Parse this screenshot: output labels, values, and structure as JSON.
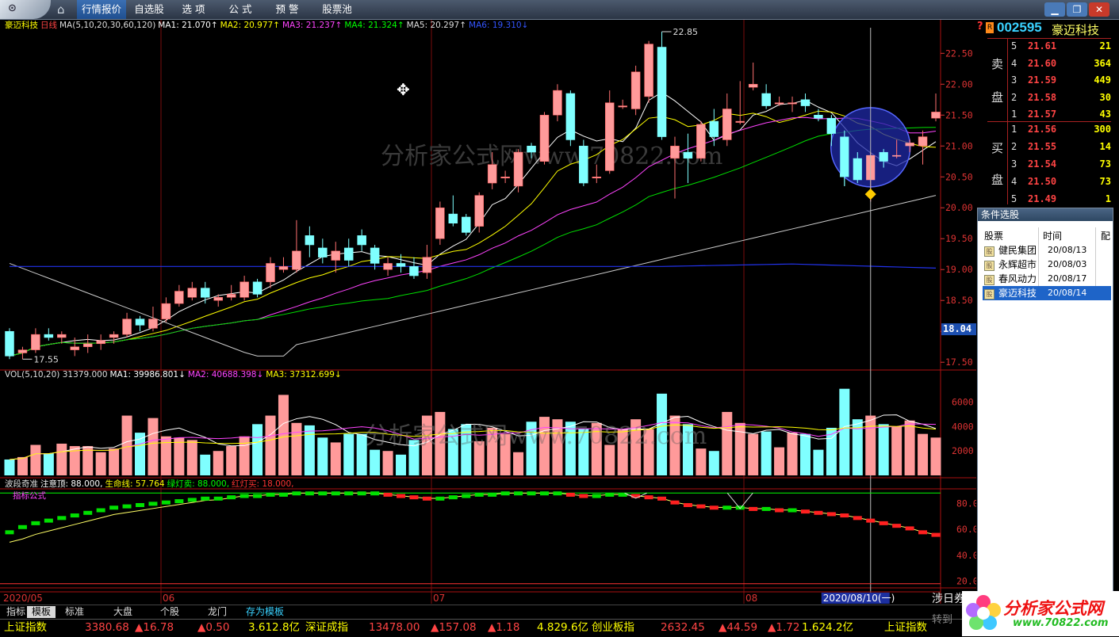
{
  "menu": {
    "items": [
      "行情报价",
      "自选股",
      "选 项",
      "公 式",
      "预 警",
      "股票池"
    ],
    "active": 0
  },
  "chart_header": {
    "stock": "豪迈科技",
    "period": "日线",
    "ma_params": "MA(5,10,20,30,60,120)",
    "ma_values": [
      {
        "label": "MA1: 21.070",
        "color": "#ffffff"
      },
      {
        "label": "MA2: 20.977",
        "color": "#ffff00"
      },
      {
        "label": "MA3: 21.237",
        "color": "#ff44ff"
      },
      {
        "label": "MA4: 21.324",
        "color": "#00ff00"
      },
      {
        "label": "MA5: 20.297",
        "color": "#dddddd"
      },
      {
        "label": "MA6: 19.310",
        "color": "#3355ff"
      }
    ]
  },
  "vol_header": {
    "label": "VOL(5,10,20) 31379.000",
    "ma_values": [
      {
        "label": "MA1: 39986.801",
        "color": "#ffffff"
      },
      {
        "label": "MA2: 40688.398",
        "color": "#ff44ff"
      },
      {
        "label": "MA3: 37312.699",
        "color": "#ffff00"
      }
    ]
  },
  "ind_header": {
    "name": "波段奇准",
    "items": [
      {
        "label": "注意顶: 88.000,",
        "color": "#ffffff"
      },
      {
        "label": "生命线: 57.764",
        "color": "#ffff00"
      },
      {
        "label": "绿灯卖: 88.000,",
        "color": "#00ff00"
      },
      {
        "label": "红灯买: 18.000,",
        "color": "#ff3333"
      }
    ],
    "sub": "指标公式"
  },
  "price_axis": [
    "22.50",
    "22.00",
    "21.50",
    "21.00",
    "20.50",
    "20.00",
    "19.50",
    "19.00",
    "18.50",
    "18.00",
    "17.50"
  ],
  "price_marker": "18.04",
  "high_label": "22.85",
  "low_label": "17.55",
  "vol_axis": [
    "6000",
    "4000",
    "2000"
  ],
  "ind_axis": [
    "80.0",
    "60.0",
    "40.0",
    "20.0"
  ],
  "date_axis": [
    "2020/05",
    "06",
    "07",
    "08"
  ],
  "cursor_date": "2020/08/10(一)",
  "watermark": "分析家公式网www.70822.com",
  "quote": {
    "code": "002595",
    "name": "豪迈科技",
    "sell_label": [
      "卖",
      "盘"
    ],
    "buy_label": [
      "买",
      "盘"
    ],
    "sell": [
      {
        "level": "5",
        "price": "21.61",
        "vol": "21"
      },
      {
        "level": "4",
        "price": "21.60",
        "vol": "364"
      },
      {
        "level": "3",
        "price": "21.59",
        "vol": "449"
      },
      {
        "level": "2",
        "price": "21.58",
        "vol": "30"
      },
      {
        "level": "1",
        "price": "21.57",
        "vol": "43"
      }
    ],
    "buy": [
      {
        "level": "1",
        "price": "21.56",
        "vol": "300"
      },
      {
        "level": "2",
        "price": "21.55",
        "vol": "14"
      },
      {
        "level": "3",
        "price": "21.54",
        "vol": "73"
      },
      {
        "level": "4",
        "price": "21.50",
        "vol": "73"
      },
      {
        "level": "5",
        "price": "21.49",
        "vol": "1"
      }
    ]
  },
  "panel": {
    "title": "条件选股",
    "headers": [
      "股票",
      "时间",
      "配"
    ],
    "rows": [
      {
        "name": "健民集团",
        "date": "20/08/13"
      },
      {
        "name": "永辉超市",
        "date": "20/08/03"
      },
      {
        "name": "春风动力",
        "date": "20/08/17"
      },
      {
        "name": "豪迈科技",
        "date": "20/08/14"
      }
    ],
    "selected": 3
  },
  "bottom_tabs": [
    "指标",
    "模板",
    "标准",
    "大盘",
    "个股",
    "龙门",
    "存为模板"
  ],
  "ticker": [
    {
      "text": "上证指数",
      "color": "#ffff00"
    },
    {
      "text": "3380.68",
      "color": "#ff4444"
    },
    {
      "text": "▲16.78",
      "color": "#ff4444"
    },
    {
      "text": "▲0.50",
      "color": "#ff4444"
    },
    {
      "text": "3.612.8亿",
      "color": "#ffff00"
    },
    {
      "text": "深证成指",
      "color": "#ffff00"
    },
    {
      "text": "13478.00",
      "color": "#ff4444"
    },
    {
      "text": "▲157.08",
      "color": "#ff4444"
    },
    {
      "text": "▲1.18",
      "color": "#ff4444"
    },
    {
      "text": "4.829.6亿",
      "color": "#ffff00"
    },
    {
      "text": "创业板指",
      "color": "#ffff00"
    },
    {
      "text": "2632.45",
      "color": "#ff4444"
    },
    {
      "text": "▲44.59",
      "color": "#ff4444"
    },
    {
      "text": "▲1.72",
      "color": "#ff4444"
    },
    {
      "text": "1.624.2亿",
      "color": "#ffff00"
    },
    {
      "text": "上证指数",
      "color": "#ffff00"
    }
  ],
  "side_text": "涉日券",
  "goto_text": "转到",
  "brand": {
    "name": "分析家公式网",
    "url": "www.70822.com"
  },
  "chart_data": {
    "type": "candlestick",
    "title": "豪迈科技 日线",
    "ylim": [
      17.4,
      22.85
    ],
    "candles": [
      [
        18.0,
        17.6,
        18.05,
        17.55
      ],
      [
        17.65,
        17.7,
        17.75,
        17.55
      ],
      [
        17.7,
        17.95,
        18.05,
        17.65
      ],
      [
        17.95,
        17.9,
        18.05,
        17.85
      ],
      [
        17.9,
        17.95,
        18.0,
        17.8
      ],
      [
        17.7,
        17.75,
        17.9,
        17.6
      ],
      [
        17.75,
        17.8,
        17.95,
        17.65
      ],
      [
        17.8,
        17.85,
        17.95,
        17.7
      ],
      [
        17.9,
        17.95,
        18.0,
        17.8
      ],
      [
        17.95,
        18.2,
        18.3,
        17.9
      ],
      [
        18.2,
        18.1,
        18.25,
        18.0
      ],
      [
        18.05,
        18.2,
        18.4,
        18.0
      ],
      [
        18.2,
        18.45,
        18.55,
        18.15
      ],
      [
        18.45,
        18.65,
        18.75,
        18.4
      ],
      [
        18.55,
        18.7,
        18.8,
        18.5
      ],
      [
        18.7,
        18.55,
        18.8,
        18.45
      ],
      [
        18.5,
        18.55,
        18.6,
        18.4
      ],
      [
        18.55,
        18.6,
        18.75,
        18.5
      ],
      [
        18.55,
        18.8,
        18.9,
        18.5
      ],
      [
        18.8,
        18.6,
        18.85,
        18.55
      ],
      [
        18.8,
        19.1,
        19.2,
        18.7
      ],
      [
        19.0,
        19.05,
        19.2,
        18.95
      ],
      [
        19.0,
        19.3,
        19.8,
        18.95
      ],
      [
        19.55,
        19.4,
        19.7,
        19.2
      ],
      [
        19.35,
        19.2,
        19.5,
        19.1
      ],
      [
        19.15,
        19.3,
        19.45,
        18.95
      ],
      [
        19.35,
        19.15,
        19.5,
        19.05
      ],
      [
        19.55,
        19.4,
        19.65,
        19.3
      ],
      [
        19.35,
        19.1,
        19.4,
        19.0
      ],
      [
        19.0,
        19.1,
        19.2,
        18.9
      ],
      [
        19.1,
        19.05,
        19.25,
        18.95
      ],
      [
        19.05,
        18.9,
        19.2,
        18.85
      ],
      [
        18.95,
        19.2,
        19.4,
        18.85
      ],
      [
        19.5,
        20.0,
        20.1,
        19.4
      ],
      [
        19.9,
        19.75,
        20.2,
        19.7
      ],
      [
        19.85,
        19.6,
        19.9,
        19.55
      ],
      [
        19.7,
        20.2,
        20.25,
        19.6
      ],
      [
        20.4,
        20.7,
        20.9,
        20.3
      ],
      [
        20.5,
        20.5,
        20.6,
        20.4
      ],
      [
        20.35,
        20.9,
        20.95,
        20.25
      ],
      [
        21.0,
        20.9,
        21.05,
        20.8
      ],
      [
        20.75,
        21.5,
        21.55,
        20.7
      ],
      [
        21.5,
        21.9,
        22.0,
        21.4
      ],
      [
        21.85,
        21.1,
        21.9,
        21.0
      ],
      [
        21.0,
        20.4,
        21.1,
        20.35
      ],
      [
        20.5,
        20.5,
        20.7,
        20.4
      ],
      [
        20.6,
        21.7,
        21.9,
        20.55
      ],
      [
        21.65,
        21.65,
        21.75,
        21.6
      ],
      [
        21.6,
        22.2,
        22.3,
        21.5
      ],
      [
        21.8,
        22.65,
        22.7,
        21.7
      ],
      [
        22.6,
        21.15,
        22.85,
        21.1
      ],
      [
        20.8,
        21.0,
        21.15,
        20.15
      ],
      [
        20.9,
        20.8,
        21.2,
        20.4
      ],
      [
        20.8,
        21.35,
        21.4,
        20.75
      ],
      [
        21.4,
        21.15,
        21.6,
        21.0
      ],
      [
        21.1,
        21.6,
        21.85,
        21.0
      ],
      [
        21.4,
        21.4,
        22.05,
        21.35
      ],
      [
        21.95,
        22.0,
        22.35,
        21.9
      ],
      [
        21.85,
        21.65,
        22.0,
        21.6
      ],
      [
        21.7,
        21.7,
        21.8,
        21.65
      ],
      [
        21.7,
        21.7,
        21.8,
        21.55
      ],
      [
        21.75,
        21.65,
        21.85,
        21.55
      ],
      [
        21.5,
        21.45,
        21.6,
        21.4
      ],
      [
        21.45,
        21.2,
        21.5,
        21.0
      ],
      [
        21.15,
        20.5,
        21.25,
        20.35
      ],
      [
        20.8,
        20.45,
        20.9,
        20.4
      ],
      [
        20.45,
        20.85,
        20.9,
        20.1
      ],
      [
        20.9,
        20.75,
        20.95,
        20.65
      ],
      [
        20.85,
        20.85,
        21.1,
        20.8
      ],
      [
        21.0,
        21.05,
        21.1,
        20.9
      ],
      [
        21.0,
        21.15,
        21.25,
        20.7
      ],
      [
        21.45,
        21.55,
        21.85,
        21.4
      ]
    ],
    "volumes": [
      1300,
      1500,
      2500,
      1800,
      2600,
      2400,
      2400,
      1900,
      2200,
      4900,
      3500,
      4700,
      3200,
      3100,
      2900,
      1700,
      2000,
      2400,
      3200,
      4200,
      4900,
      6600,
      4300,
      4100,
      3100,
      2700,
      3400,
      3400,
      2100,
      2000,
      1700,
      2900,
      4900,
      5200,
      3800,
      4200,
      2800,
      3900,
      3400,
      1900,
      4400,
      4800,
      4600,
      4400,
      3800,
      4300,
      2500,
      3800,
      4600,
      3800,
      6700,
      4900,
      4200,
      2200,
      2000,
      5200,
      4300,
      3400,
      3600,
      2300,
      3500,
      3400,
      2100,
      3900,
      7100,
      4600,
      4900,
      4200,
      4000,
      4500,
      3400,
      3100
    ],
    "ind": [
      58,
      62,
      65,
      67,
      69,
      71,
      73,
      75,
      77,
      78,
      79,
      80,
      81,
      82,
      83,
      84,
      84,
      85,
      86,
      86,
      87,
      87,
      88,
      88,
      88,
      88,
      88,
      88,
      88,
      87,
      86,
      85,
      84,
      84,
      85,
      86,
      87,
      87,
      88,
      88,
      88,
      88,
      88,
      87,
      86,
      86,
      87,
      87,
      86,
      85,
      84,
      81,
      79,
      78,
      77,
      77,
      77,
      76,
      76,
      75,
      75,
      74,
      73,
      72,
      71,
      69,
      67,
      65,
      63,
      61,
      58,
      56
    ]
  }
}
